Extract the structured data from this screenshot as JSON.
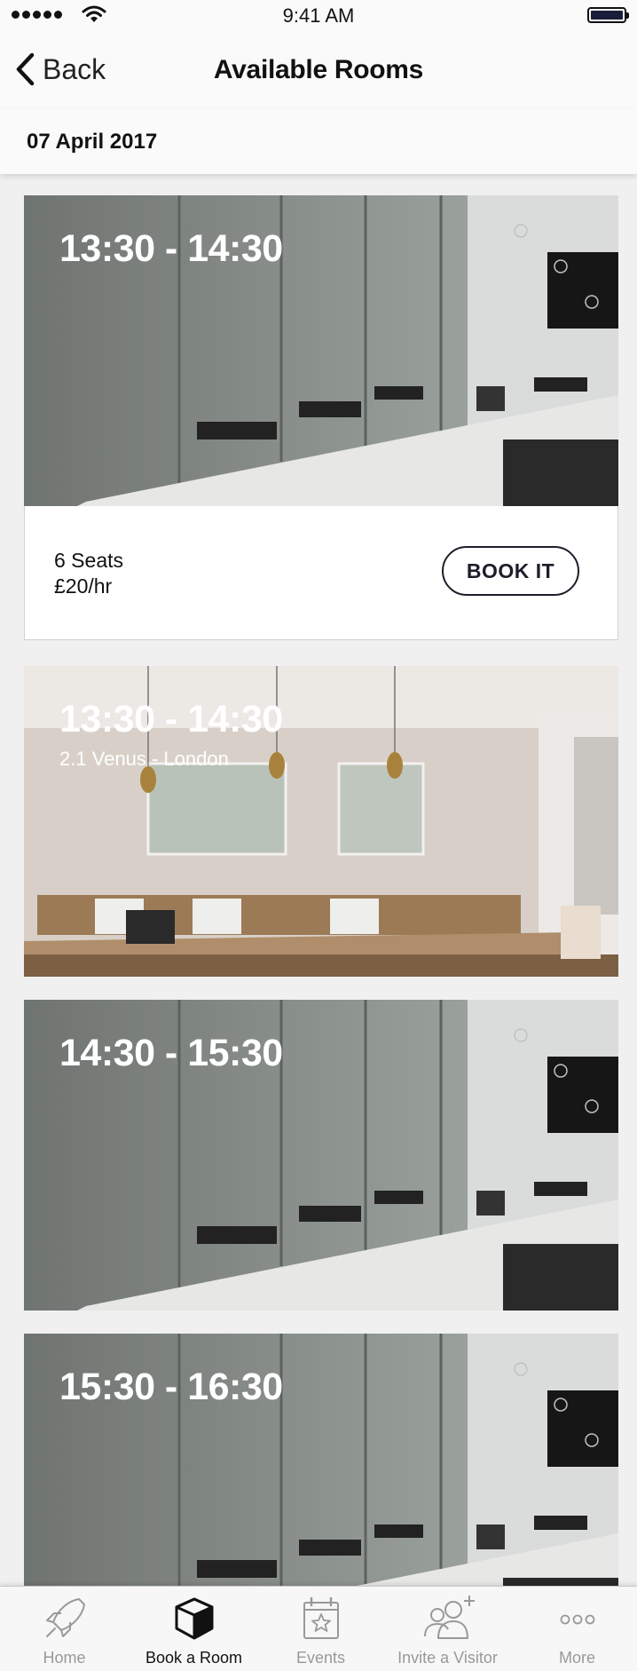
{
  "status_bar": {
    "time": "9:41 AM"
  },
  "nav": {
    "back_label": "Back",
    "title": "Available Rooms"
  },
  "date": "07 April 2017",
  "rooms": [
    {
      "time": "13:30 - 14:30",
      "name": "",
      "seats": "6 Seats",
      "price": "£20/hr",
      "book_label": "BOOK IT",
      "photo": "glass-meeting-room"
    },
    {
      "time": "13:30 - 14:30",
      "name": "2.1 Venus - London",
      "photo": "warm-meeting-room"
    },
    {
      "time": "14:30 - 15:30",
      "name": "",
      "photo": "glass-meeting-room"
    },
    {
      "time": "15:30 - 16:30",
      "name": "",
      "photo": "glass-meeting-room"
    }
  ],
  "tabs": [
    {
      "label": "Home",
      "icon": "rocket-icon",
      "active": false
    },
    {
      "label": "Book a Room",
      "icon": "cube-icon",
      "active": true
    },
    {
      "label": "Events",
      "icon": "calendar-star-icon",
      "active": false
    },
    {
      "label": "Invite a Visitor",
      "icon": "add-people-icon",
      "active": false
    },
    {
      "label": "More",
      "icon": "more-dots-icon",
      "active": false
    }
  ],
  "colors": {
    "accent": "#1e1e2a",
    "tab_inactive": "#999999",
    "background": "#f0f0f0"
  }
}
